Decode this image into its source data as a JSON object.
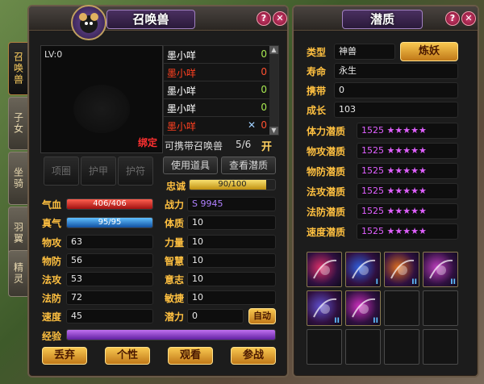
{
  "left_panel": {
    "title": "召唤兽",
    "help": "?",
    "close": "✕",
    "level": "LV:0",
    "bound": "绑定",
    "pet_list": [
      {
        "name": "墨小咩",
        "count": "0",
        "name_color": "#ffffff"
      },
      {
        "name": "墨小咩",
        "count": "0",
        "name_color": "#ff4020"
      },
      {
        "name": "墨小咩",
        "count": "0",
        "name_color": "#ffffff"
      },
      {
        "name": "墨小咩",
        "count": "0",
        "name_color": "#ffffff"
      },
      {
        "name": "墨小咩",
        "count": "0",
        "name_color": "#ff4020"
      }
    ],
    "carry_label": "可携带召唤兽",
    "carry_value": "5/6",
    "carry_btn": "开",
    "equip_slots": [
      "项圈",
      "护甲",
      "护符"
    ],
    "use_item_btn": "使用道具",
    "view_potential_btn": "查看潜质",
    "loyalty": {
      "label": "忠诚",
      "text": "90/100",
      "fraction": 0.9
    },
    "hp": {
      "label": "气血",
      "text": "406/406",
      "fraction": 1.0
    },
    "mp": {
      "label": "真气",
      "text": "95/95",
      "fraction": 1.0
    },
    "stats_left": [
      {
        "label": "物攻",
        "value": "63"
      },
      {
        "label": "物防",
        "value": "56"
      },
      {
        "label": "法攻",
        "value": "53"
      },
      {
        "label": "法防",
        "value": "72"
      },
      {
        "label": "速度",
        "value": "45"
      }
    ],
    "stats_right": [
      {
        "label": "战力",
        "value": "S 9945"
      },
      {
        "label": "体质",
        "value": "10"
      },
      {
        "label": "力量",
        "value": "10"
      },
      {
        "label": "智慧",
        "value": "10"
      },
      {
        "label": "意志",
        "value": "10"
      },
      {
        "label": "敏捷",
        "value": "10"
      },
      {
        "label": "潜力",
        "value": "0"
      }
    ],
    "auto_btn": "自动",
    "exp_label": "经验",
    "exp_fraction": 1.0,
    "bottom_buttons": [
      "丢弃",
      "个性",
      "观看",
      "参战"
    ]
  },
  "side_tabs": [
    "召唤兽",
    "子女",
    "坐骑",
    "羽翼",
    "精灵"
  ],
  "right_panel": {
    "title": "潜质",
    "help": "?",
    "close": "✕",
    "type_label": "类型",
    "type_value": "神兽",
    "refine_btn": "炼妖",
    "life_label": "寿命",
    "life_value": "永生",
    "carry_label": "携带",
    "carry_value": "0",
    "growth_label": "成长",
    "growth_value": "103",
    "aptitudes": [
      {
        "label": "体力潜质",
        "value": "1525",
        "stars": "★★★★★"
      },
      {
        "label": "物攻潜质",
        "value": "1525",
        "stars": "★★★★★"
      },
      {
        "label": "物防潜质",
        "value": "1525",
        "stars": "★★★★★"
      },
      {
        "label": "法攻潜质",
        "value": "1525",
        "stars": "★★★★★"
      },
      {
        "label": "法防潜质",
        "value": "1525",
        "stars": "★★★★★"
      },
      {
        "label": "速度潜质",
        "value": "1525",
        "stars": "★★★★★"
      }
    ],
    "skills": [
      {
        "icon": "pink-comet-skill-icon",
        "color": "#e0306a",
        "tag": ""
      },
      {
        "icon": "blue-slash-skill-icon",
        "color": "#3060e0",
        "tag": "I"
      },
      {
        "icon": "fire-figure-skill-icon",
        "color": "#e07020",
        "tag": "II"
      },
      {
        "icon": "purple-swirl-skill-icon",
        "color": "#c040c0",
        "tag": "II"
      },
      {
        "icon": "purple-rune-skill-icon",
        "color": "#6050d0",
        "tag": "II"
      },
      {
        "icon": "lightning-skill-icon",
        "color": "#d030c0",
        "tag": "II"
      }
    ]
  }
}
